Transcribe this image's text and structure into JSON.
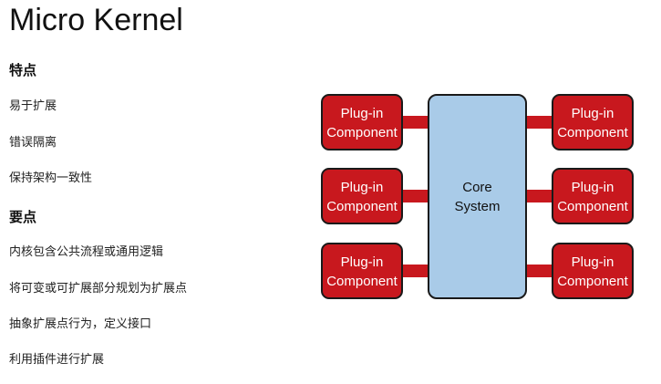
{
  "page": {
    "title": "Micro Kernel"
  },
  "features": {
    "heading": "特点",
    "items": [
      "易于扩展",
      "错误隔离",
      "保持架构一致性"
    ]
  },
  "key_points": {
    "heading": "要点",
    "items": [
      "内核包含公共流程或通用逻辑",
      "将可变或可扩展部分规划为扩展点",
      "抽象扩展点行为，定义接口",
      "利用插件进行扩展"
    ]
  },
  "diagram": {
    "core": {
      "line1": "Core",
      "line2": "System"
    },
    "plugins": [
      {
        "line1": "Plug-in",
        "line2": "Component"
      },
      {
        "line1": "Plug-in",
        "line2": "Component"
      },
      {
        "line1": "Plug-in",
        "line2": "Component"
      },
      {
        "line1": "Plug-in",
        "line2": "Component"
      },
      {
        "line1": "Plug-in",
        "line2": "Component"
      },
      {
        "line1": "Plug-in",
        "line2": "Component"
      }
    ],
    "colors": {
      "plugin_fill": "#c8181e",
      "plugin_stroke": "#1a1a1a",
      "connector": "#c8181e",
      "core_fill": "#a9cbe8",
      "core_stroke": "#1a1a1a",
      "plugin_text": "#ffffff",
      "core_text": "#111111"
    }
  }
}
